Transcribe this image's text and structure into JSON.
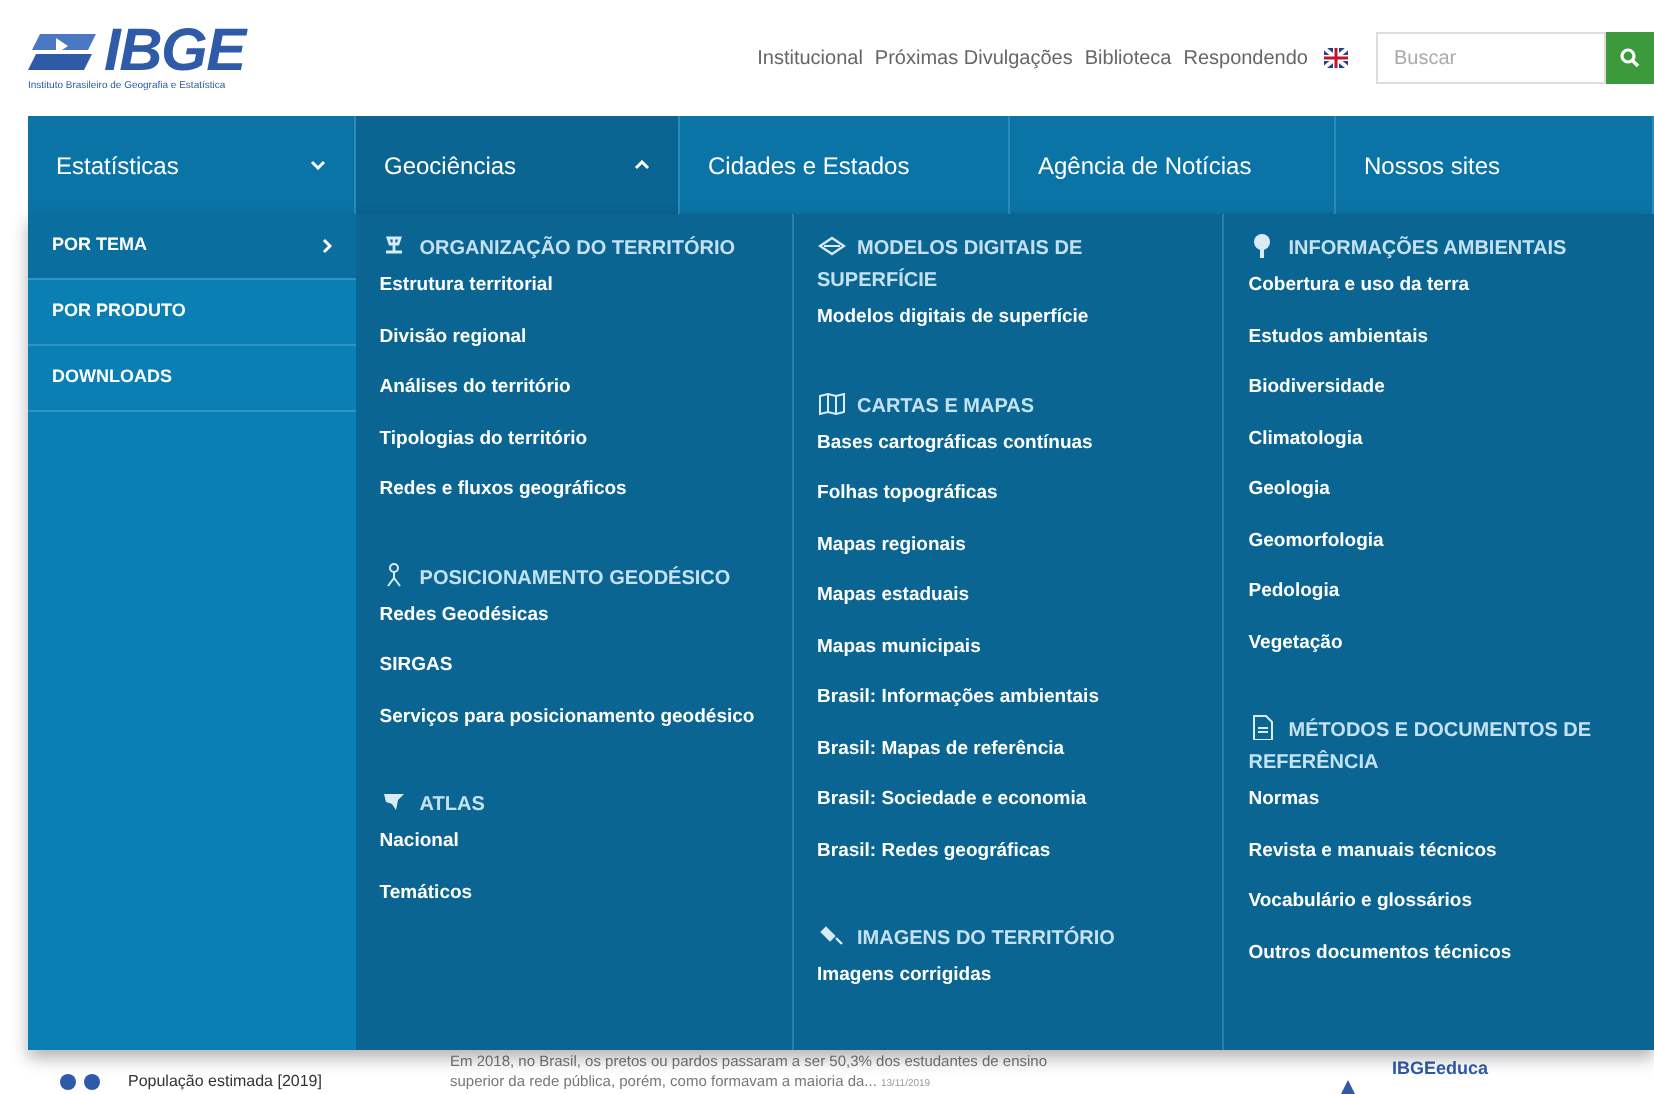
{
  "header": {
    "logo": "IBGE",
    "logo_subtitle": "Instituto Brasileiro de Geografia e Estatística",
    "links": [
      "Institucional",
      "Próximas Divulgações",
      "Biblioteca",
      "Respondendo"
    ],
    "search": {
      "placeholder": "Buscar"
    }
  },
  "nav": [
    {
      "kind": "dropdown",
      "label": "Estatísticas",
      "selected": false,
      "expanded": false
    },
    {
      "kind": "dropdown",
      "label": "Geociências",
      "selected": true,
      "expanded": true
    },
    {
      "kind": "link",
      "label": "Cidades e Estados",
      "selected": false
    },
    {
      "kind": "link",
      "label": "Agência de Notícias",
      "selected": false
    },
    {
      "kind": "link",
      "label": "Nossos sites",
      "selected": false
    }
  ],
  "submenu": [
    {
      "label": "POR TEMA",
      "selected": true
    },
    {
      "label": "POR PRODUTO",
      "selected": false
    },
    {
      "label": "DOWNLOADS",
      "selected": false
    }
  ],
  "columns": [
    {
      "sections": [
        {
          "title": "ORGANIZAÇÃO DO TERRITÓRIO",
          "links": [
            "Estrutura territorial",
            "Divisão regional",
            "Análises do território",
            "Tipologias do território",
            "Redes e fluxos geográficos"
          ]
        },
        {
          "title": "POSICIONAMENTO GEODÉSICO",
          "links": [
            "Redes Geodésicas",
            "SIRGAS",
            "Serviços para posicionamento geodésico"
          ]
        },
        {
          "title": "ATLAS",
          "links": [
            "Nacional",
            "Temáticos"
          ]
        }
      ]
    },
    {
      "sections": [
        {
          "title": "MODELOS DIGITAIS DE SUPERFÍCIE",
          "links": [
            "Modelos digitais de superfície"
          ]
        },
        {
          "title": "CARTAS E MAPAS",
          "links": [
            "Bases cartográficas contínuas",
            "Folhas topográficas",
            "Mapas regionais",
            "Mapas estaduais",
            "Mapas municipais",
            "Brasil: Informações ambientais",
            "Brasil: Mapas de referência",
            "Brasil: Sociedade e economia",
            "Brasil: Redes geográficas"
          ]
        },
        {
          "title": "IMAGENS DO TERRITÓRIO",
          "links": [
            "Imagens corrigidas"
          ]
        }
      ]
    },
    {
      "sections": [
        {
          "title": "INFORMAÇÕES AMBIENTAIS",
          "links": [
            "Cobertura e uso da terra",
            "Estudos ambientais",
            "Biodiversidade",
            "Climatologia",
            "Geologia",
            "Geomorfologia",
            "Pedologia",
            "Vegetação"
          ]
        },
        {
          "title": "MÉTODOS E DOCUMENTOS DE REFERÊNCIA",
          "links": [
            "Normas",
            "Revista e manuais técnicos",
            "Vocabulário e glossários",
            "Outros documentos técnicos"
          ]
        }
      ]
    }
  ],
  "below": {
    "stat_label": "População estimada [2019]",
    "news_line_1": "Em 2018, no Brasil, os pretos ou pardos passaram a ser 50,3% dos estudantes de ensino",
    "news_line_2": "superior da rede pública, porém, como formavam a maioria da...",
    "news_date": "13/11/2019",
    "side_title": "IBGEeduca"
  }
}
